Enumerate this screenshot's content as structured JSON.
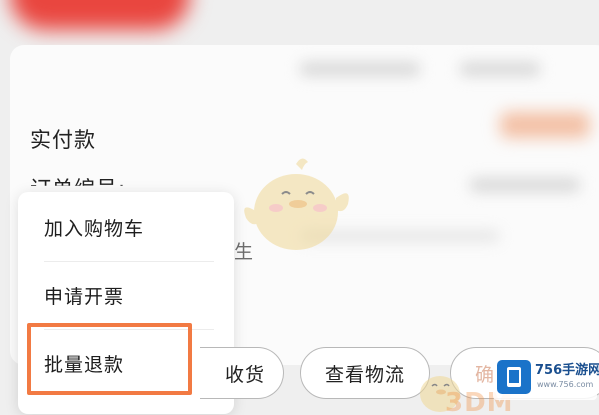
{
  "background": {
    "actual_payment_label": "实付款",
    "order_number_label": "订单编号:",
    "faded_text": "生"
  },
  "popup_menu": {
    "items": [
      {
        "label": "加入购物车"
      },
      {
        "label": "申请开票"
      },
      {
        "label": "批量退款"
      }
    ],
    "highlighted_index": 2,
    "highlight_color": "#f27a43"
  },
  "bottom_actions": {
    "confirm_receipt_partial": "收货",
    "view_logistics": "查看物流",
    "confirm_partial": "确"
  },
  "watermark": {
    "site_name": "756手游网",
    "site_url": "www.756.com",
    "brand_text": "3DM"
  },
  "icons": {
    "mascot": "chick-mascot-icon",
    "logo": "phone-box-logo-icon"
  }
}
